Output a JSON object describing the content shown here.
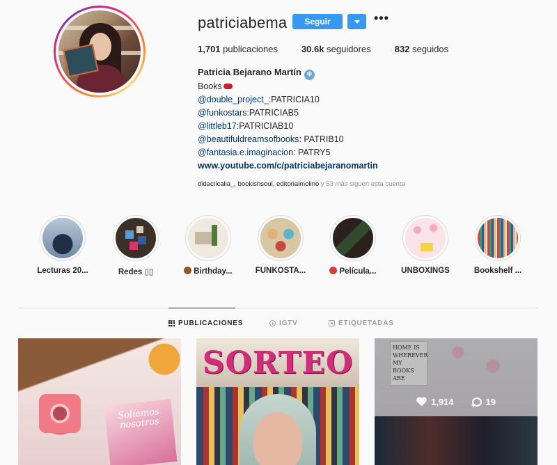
{
  "profile": {
    "username": "patriciabema",
    "follow_label": "Seguir",
    "more_label": "•••",
    "stats": [
      {
        "count": "1,701",
        "label": "publicaciones"
      },
      {
        "count": "30.6k",
        "label": "seguidores"
      },
      {
        "count": "832",
        "label": "seguidos"
      }
    ],
    "full_name": "Patricia Bejarano Martín",
    "bio": {
      "line1": "Books",
      "codes": [
        {
          "tag": "@double_project_",
          "code": ":PATRICIA10"
        },
        {
          "tag": "@funkostars",
          "code": ":PATRICIAB5"
        },
        {
          "tag": "@littleb17",
          "code": ":PATRICIAB10"
        },
        {
          "tag": "@beautifuldreamsofbooks",
          "code": ": PATRIB10"
        },
        {
          "tag": "@fantasia.e.imaginacion",
          "code": ": PATRY5"
        }
      ],
      "url": "www.youtube.com/c/patriciabejaranomartin"
    },
    "followed_by": {
      "names": "didacticalia_, bookishsoul, editorialmolino",
      "suffix": " y 53 más siguen esta cuenta"
    }
  },
  "highlights": [
    {
      "label": "Lecturas 20..."
    },
    {
      "label": "Redes ▯▯"
    },
    {
      "label": "Birthday..."
    },
    {
      "label": "FUNKOSTA..."
    },
    {
      "label": "Película..."
    },
    {
      "label": "UNBOXINGS"
    },
    {
      "label": "Bookshelf ..."
    }
  ],
  "tabs": {
    "posts": "PUBLICACIONES",
    "igtv": "IGTV",
    "tagged": "ETIQUETADAS"
  },
  "posts": [
    {
      "caption": "Solíamos nosotros"
    },
    {
      "caption": "SORTEO"
    },
    {
      "quote": "HOME IS WHEREVER MY BOOKS ARE",
      "likes": "1,914",
      "comments": "19"
    }
  ],
  "colors": {
    "accent": "#3897f0",
    "link": "#003569",
    "text": "#262626",
    "muted": "#8e8e8e",
    "background": "#fafafa"
  }
}
